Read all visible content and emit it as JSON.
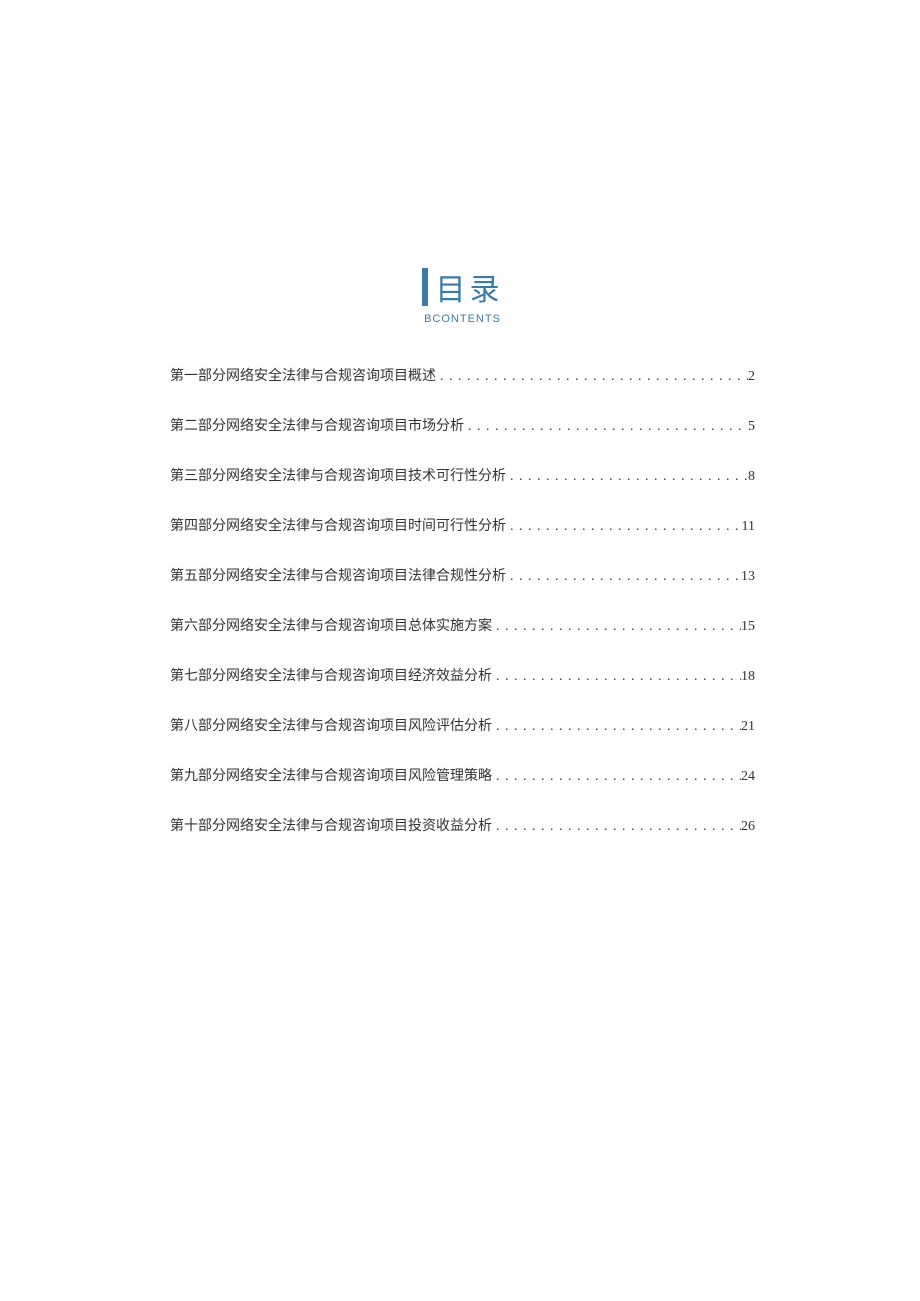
{
  "header": {
    "title": "目录",
    "subtitle": "BCONTENTS"
  },
  "toc": [
    {
      "text": "第一部分网络安全法律与合规咨询项目概述",
      "page": "2"
    },
    {
      "text": "第二部分网络安全法律与合规咨询项目市场分析",
      "page": "5"
    },
    {
      "text": "第三部分网络安全法律与合规咨询项目技术可行性分析",
      "page": "8"
    },
    {
      "text": "第四部分网络安全法律与合规咨询项目时间可行性分析",
      "page": "11"
    },
    {
      "text": "第五部分网络安全法律与合规咨询项目法律合规性分析",
      "page": "13"
    },
    {
      "text": "第六部分网络安全法律与合规咨询项目总体实施方案",
      "page": "15"
    },
    {
      "text": "第七部分网络安全法律与合规咨询项目经济效益分析",
      "page": "18"
    },
    {
      "text": "第八部分网络安全法律与合规咨询项目风险评估分析",
      "page": "21"
    },
    {
      "text": "第九部分网络安全法律与合规咨询项目风险管理策略",
      "page": "24"
    },
    {
      "text": "第十部分网络安全法律与合规咨询项目投资收益分析",
      "page": "26"
    }
  ]
}
